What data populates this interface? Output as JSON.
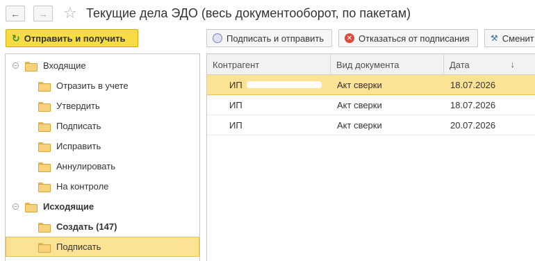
{
  "window": {
    "title": "Текущие дела ЭДО (весь документооборот, по пакетам)",
    "back_icon": "arrow-left-icon",
    "forward_icon": "arrow-right-icon",
    "favorite_icon": "star-icon"
  },
  "toolbar": {
    "send_receive_label": "Отправить и получить",
    "sign_send_label": "Подписать и отправить",
    "reject_label": "Отказаться от подписания",
    "change_label": "Сменит"
  },
  "tree": {
    "incoming": {
      "label": "Входящие",
      "items": [
        {
          "label": "Отразить в учете"
        },
        {
          "label": "Утвердить"
        },
        {
          "label": "Подписать"
        },
        {
          "label": "Исправить"
        },
        {
          "label": "Аннулировать"
        },
        {
          "label": "На контроле"
        }
      ]
    },
    "outgoing": {
      "label": "Исходящие",
      "items": [
        {
          "label": "Создать (147)"
        },
        {
          "label": "Подписать"
        }
      ]
    },
    "selected": "Исходящие / Подписать"
  },
  "grid": {
    "columns": [
      "Контрагент",
      "Вид документа",
      "Дата"
    ],
    "sort_indicator": "↓",
    "rows": [
      {
        "counterparty": "ИП",
        "doc_type": "Акт сверки",
        "date": "18.07.2026",
        "selected": true
      },
      {
        "counterparty": "ИП",
        "doc_type": "Акт сверки",
        "date": "18.07.2026",
        "selected": false
      },
      {
        "counterparty": "ИП",
        "doc_type": "Акт сверки",
        "date": "20.07.2026",
        "selected": false
      }
    ]
  },
  "colors": {
    "accent_yellow": "#f7dc44",
    "selection": "#fbe295",
    "border": "#c8c8c8"
  }
}
